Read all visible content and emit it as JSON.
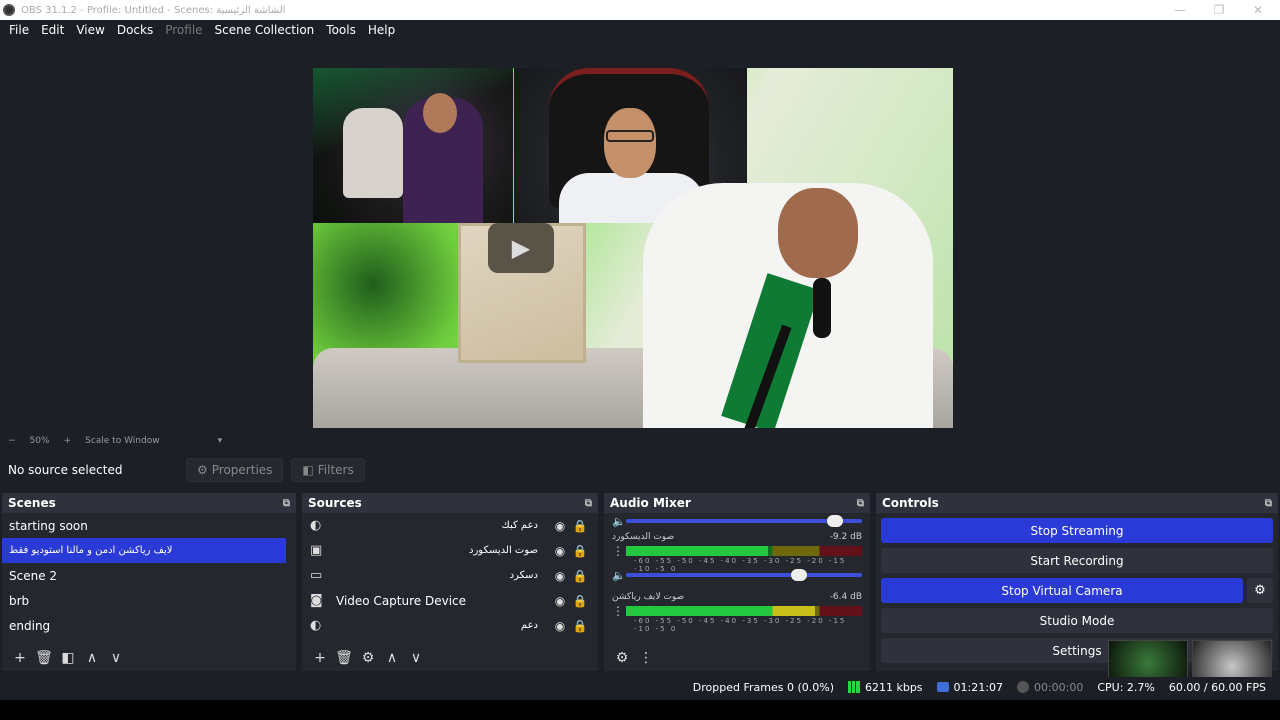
{
  "window": {
    "title": "OBS 31.1.2 - Profile: Untitled - Scenes: الشاشة الرئيسية",
    "minimize_icon": "—",
    "restore_icon": "❐",
    "close_icon": "✕"
  },
  "menu": [
    {
      "label": "File"
    },
    {
      "label": "Edit"
    },
    {
      "label": "View"
    },
    {
      "label": "Docks"
    },
    {
      "label": "Profile"
    },
    {
      "label": "Scene Collection"
    },
    {
      "label": "Tools"
    },
    {
      "label": "Help"
    }
  ],
  "zoom": {
    "minus": "−",
    "value": "50%",
    "plus": "+",
    "mode": "Scale to Window",
    "arrow": "▾"
  },
  "source_toolbar": {
    "no_source": "No source selected",
    "properties": "Properties",
    "filters": "Filters"
  },
  "scenes": {
    "title": "Scenes",
    "items": [
      {
        "label": "starting soon"
      },
      {
        "label": "لايف رياكشن ادمن و مالنا استوديو فقط"
      },
      {
        "label": "Scene 2"
      },
      {
        "label": "brb"
      },
      {
        "label": "ending"
      }
    ],
    "active_index": 1
  },
  "sources": {
    "title": "Sources",
    "items": [
      {
        "name": "دعم كبك",
        "icon": "globe-icon"
      },
      {
        "name": "صوت الديسكورد",
        "icon": "audio-icon"
      },
      {
        "name": "دسكرد",
        "icon": "monitor-icon"
      },
      {
        "name": "Video Capture Device",
        "icon": "camera-icon"
      },
      {
        "name": "دعم",
        "icon": "globe-icon"
      }
    ]
  },
  "mixer": {
    "title": "Audio Mixer",
    "channels": [
      {
        "name": "صوت الديسكورد",
        "db": "-9.2 dB",
        "level": 0.6,
        "volume": 0.75
      },
      {
        "name": "صوت لايف رياكشن",
        "db": "-6.4 dB",
        "level": 0.8,
        "volume": 0.7
      }
    ],
    "ticks": "-60 -55 -50 -45 -40 -35 -30 -25 -20 -15 -10 -5 0"
  },
  "controls": {
    "title": "Controls",
    "stop_streaming": "Stop Streaming",
    "start_recording": "Start Recording",
    "stop_virtual_camera": "Stop Virtual Camera",
    "studio_mode": "Studio Mode",
    "settings": "Settings"
  },
  "status": {
    "dropped_frames": "Dropped Frames 0 (0.0%)",
    "bitrate": "6211 kbps",
    "live_time": "01:21:07",
    "rec_time": "00:00:00",
    "cpu": "CPU: 2.7%",
    "fps": "60.00 / 60.00 FPS"
  },
  "colors": {
    "accent": "#2a3ad6",
    "panel": "#25272f",
    "background": "#1d1f26"
  }
}
